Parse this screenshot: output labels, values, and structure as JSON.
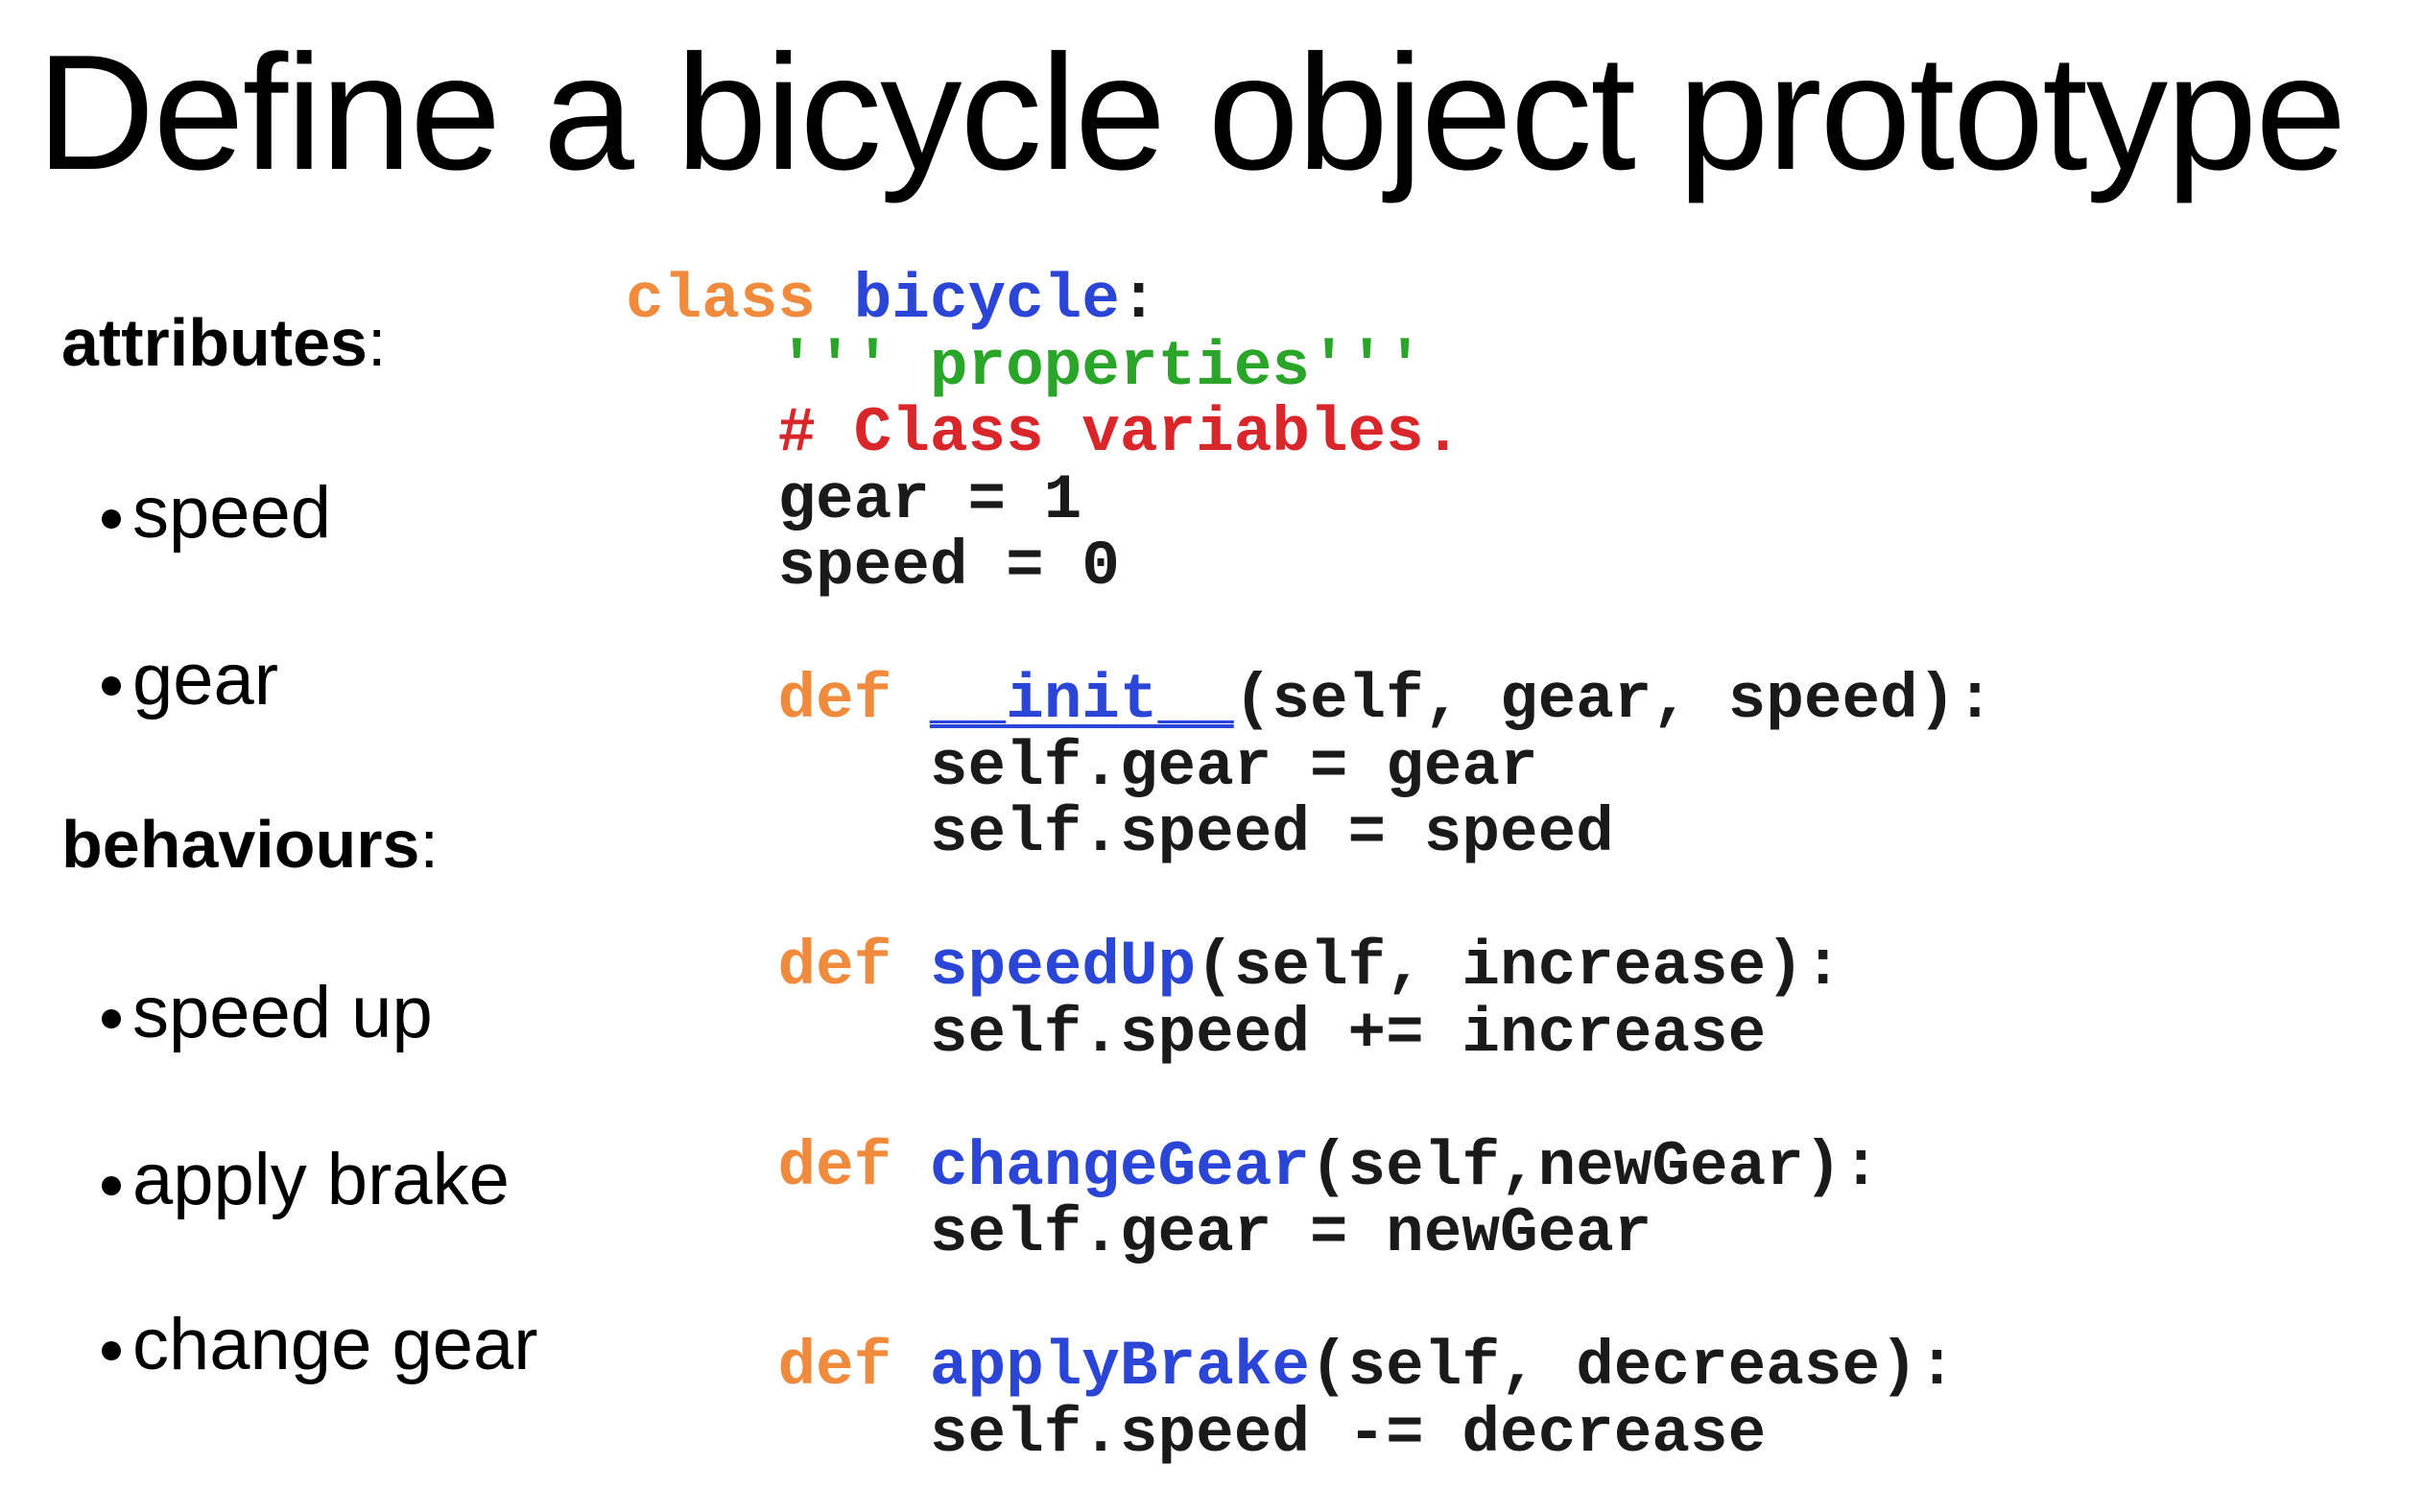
{
  "title": "Define a bicycle object prototype",
  "attributes": {
    "heading": "attributes",
    "colon": ":",
    "items": [
      "speed",
      "gear"
    ]
  },
  "behaviours": {
    "heading": "behaviours",
    "colon": ":",
    "items": [
      "speed up",
      "apply brake",
      "change gear"
    ]
  },
  "code": {
    "lines": [
      {
        "indent": "",
        "tokens": [
          {
            "t": "class ",
            "c": "kw"
          },
          {
            "t": "bicycle",
            "c": "fn"
          },
          {
            "t": ":",
            "c": ""
          }
        ]
      },
      {
        "indent": "    ",
        "tokens": [
          {
            "t": "''' properties'''",
            "c": "doc"
          }
        ]
      },
      {
        "indent": "    ",
        "tokens": [
          {
            "t": "# Class variables.",
            "c": "cmt"
          }
        ]
      },
      {
        "indent": "    ",
        "tokens": [
          {
            "t": "gear = 1",
            "c": ""
          }
        ]
      },
      {
        "indent": "    ",
        "tokens": [
          {
            "t": "speed = 0",
            "c": ""
          }
        ]
      },
      {
        "indent": "",
        "tokens": []
      },
      {
        "indent": "    ",
        "tokens": [
          {
            "t": "def ",
            "c": "kw"
          },
          {
            "t": "__init__",
            "c": "fn ul"
          },
          {
            "t": "(self, gear, speed):",
            "c": ""
          }
        ]
      },
      {
        "indent": "        ",
        "tokens": [
          {
            "t": "self.gear = gear",
            "c": ""
          }
        ]
      },
      {
        "indent": "        ",
        "tokens": [
          {
            "t": "self.speed = speed",
            "c": ""
          }
        ]
      },
      {
        "indent": "",
        "tokens": []
      },
      {
        "indent": "    ",
        "tokens": [
          {
            "t": "def ",
            "c": "kw"
          },
          {
            "t": "speedUp",
            "c": "fn"
          },
          {
            "t": "(self, increase):",
            "c": ""
          }
        ]
      },
      {
        "indent": "        ",
        "tokens": [
          {
            "t": "self.speed += increase",
            "c": ""
          }
        ]
      },
      {
        "indent": "",
        "tokens": []
      },
      {
        "indent": "    ",
        "tokens": [
          {
            "t": "def ",
            "c": "kw"
          },
          {
            "t": "changeGear",
            "c": "fn"
          },
          {
            "t": "(self,newGear):",
            "c": ""
          }
        ]
      },
      {
        "indent": "        ",
        "tokens": [
          {
            "t": "self.gear = newGear",
            "c": ""
          }
        ]
      },
      {
        "indent": "",
        "tokens": []
      },
      {
        "indent": "    ",
        "tokens": [
          {
            "t": "def ",
            "c": "kw"
          },
          {
            "t": "applyBrake",
            "c": "fn"
          },
          {
            "t": "(self, decrease):",
            "c": ""
          }
        ]
      },
      {
        "indent": "        ",
        "tokens": [
          {
            "t": "self.speed -= decrease",
            "c": ""
          }
        ]
      }
    ]
  },
  "colors": {
    "keyword": "#f08a3c",
    "function_name": "#2b45d6",
    "docstring": "#2aa52a",
    "comment": "#d8262a",
    "text": "#1a1a1a"
  }
}
